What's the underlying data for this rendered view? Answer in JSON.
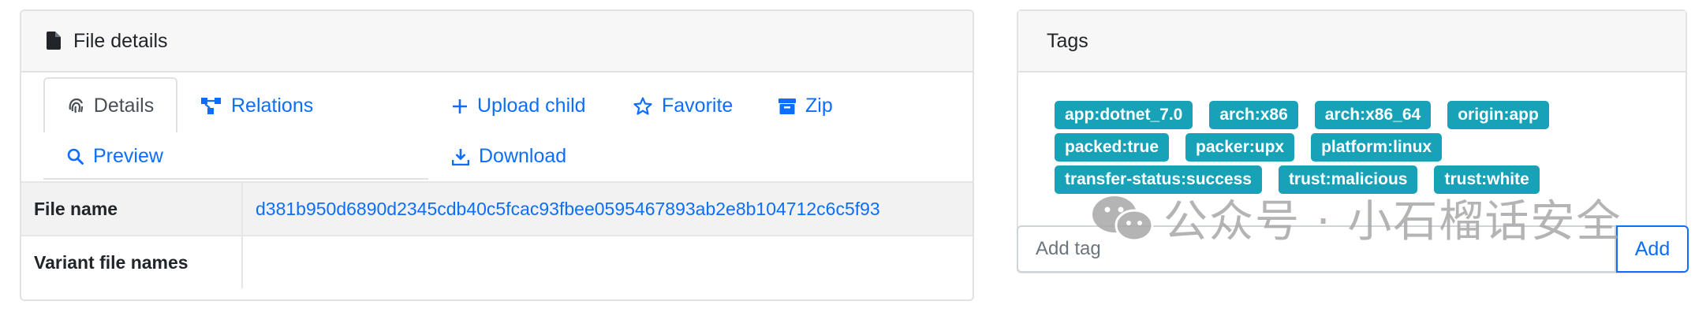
{
  "file_card": {
    "title": "File details",
    "icon": "file-icon",
    "tabs": {
      "details": "Details",
      "relations": "Relations",
      "upload_child": "Upload child",
      "favorite": "Favorite",
      "zip": "Zip",
      "preview": "Preview",
      "download": "Download"
    },
    "rows": [
      {
        "key": "File name",
        "value": "d381b950d6890d2345cdb40c5fcac93fbee0595467893ab2e8b104712c6c5f93"
      },
      {
        "key": "Variant file names",
        "value": ""
      }
    ]
  },
  "tags_card": {
    "title": "Tags",
    "tags": [
      [
        "app:dotnet_7.0",
        "arch:x86",
        "arch:x86_64",
        "origin:app"
      ],
      [
        "packed:true",
        "packer:upx",
        "platform:linux"
      ],
      [
        "transfer-status:success",
        "trust:malicious",
        "trust:white"
      ]
    ],
    "input_placeholder": "Add tag",
    "add_label": "Add",
    "tag_color": "#17a2b8"
  },
  "watermark": {
    "text": "公众号 · 小石榴话安全"
  },
  "colors": {
    "link": "#0d6efd",
    "header_bg": "#f7f7f7",
    "border": "#e2e2e2"
  }
}
